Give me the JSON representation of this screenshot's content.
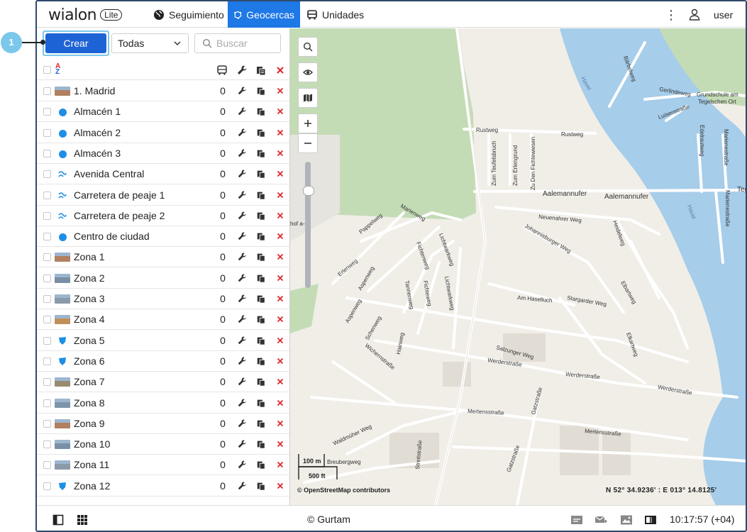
{
  "app": {
    "logo_word": "wialon",
    "logo_badge": "Lite"
  },
  "nav": {
    "tabs": [
      {
        "label": "Seguimiento",
        "icon": "globe-icon",
        "active": false
      },
      {
        "label": "Geocercas",
        "icon": "geofence-icon",
        "active": true
      },
      {
        "label": "Unidades",
        "icon": "bus-icon",
        "active": false
      }
    ],
    "user": "user"
  },
  "toolbar": {
    "create_label": "Crear",
    "filter_value": "Todas",
    "search_placeholder": "Buscar"
  },
  "callout": "1",
  "geofences": [
    {
      "name": "1. Madrid",
      "count": "0",
      "icon": "image-thumb"
    },
    {
      "name": "Almacén 1",
      "count": "0",
      "icon": "circle"
    },
    {
      "name": "Almacén 2",
      "count": "0",
      "icon": "circle"
    },
    {
      "name": "Almacén 3",
      "count": "0",
      "icon": "circle"
    },
    {
      "name": "Avenida Central",
      "count": "0",
      "icon": "line"
    },
    {
      "name": "Carretera de peaje 1",
      "count": "0",
      "icon": "line"
    },
    {
      "name": "Carretera de peaje 2",
      "count": "0",
      "icon": "line"
    },
    {
      "name": "Centro de ciudad",
      "count": "0",
      "icon": "circle"
    },
    {
      "name": "Zona 1",
      "count": "0",
      "icon": "image-thumb"
    },
    {
      "name": "Zona 2",
      "count": "0",
      "icon": "image-thumb"
    },
    {
      "name": "Zona 3",
      "count": "0",
      "icon": "image-thumb"
    },
    {
      "name": "Zona 4",
      "count": "0",
      "icon": "image-thumb"
    },
    {
      "name": "Zona 5",
      "count": "0",
      "icon": "polygon"
    },
    {
      "name": "Zona 6",
      "count": "0",
      "icon": "polygon"
    },
    {
      "name": "Zona 7",
      "count": "0",
      "icon": "image-thumb"
    },
    {
      "name": "Zona 8",
      "count": "0",
      "icon": "image-thumb"
    },
    {
      "name": "Zona 9",
      "count": "0",
      "icon": "image-thumb"
    },
    {
      "name": "Zona 10",
      "count": "0",
      "icon": "image-thumb"
    },
    {
      "name": "Zona 11",
      "count": "0",
      "icon": "image-thumb"
    },
    {
      "name": "Zona 12",
      "count": "0",
      "icon": "polygon"
    }
  ],
  "map": {
    "scale_metric": "100 m",
    "scale_imperial": "500 ft",
    "attribution": "© OpenStreetMap contributors",
    "coordinates": "N 52° 34.9236' : E 013° 14.8125'",
    "street_labels": [
      "Bärbelweg",
      "Havel",
      "Gerlindeweg",
      "Grundschule am",
      "Tegelschen Ort",
      "Luisenstraße",
      "Rustweg",
      "Rustweg",
      "Zum Teufelsbruch",
      "Zum Erlengrund",
      "Zu Den Fichtewiesen",
      "Edelrautweg",
      "Marienestraße",
      "Aalemannufer",
      "Aalemannufer",
      "Teg",
      "Neuenahrer Weg",
      "Johannisburger Weg",
      "Heidelweg",
      "Havel",
      "Marienestraße",
      "Pappelweg",
      "Marienweg",
      "Fichtenweg",
      "Lichtwarkweg",
      "Erlenweg",
      "Aspenweg",
      "Tannenweg",
      "Fichteweg",
      "Lichtwarkweg",
      "Am Haselluch",
      "Stargarder Weg",
      "Elbartweg",
      "Aspenweg",
      "Schenweg",
      "Hainweg",
      "Salzunger Weg",
      "Elkartweg",
      "Wichernstraße",
      "Werderstraße",
      "Werderstraße",
      "Werderstraße",
      "Mertensstraße",
      "Mertensstraße",
      "Gatzstraße",
      "Waldmüher Weg",
      "Breubergweg",
      "Streitstraße",
      "Gatzstraße",
      "hof a-g"
    ],
    "accent_water": "#a6cdea",
    "accent_green": "#bcd8b2"
  },
  "footer": {
    "copyright": "© Gurtam",
    "clock": "10:17:57 (+04)"
  },
  "colors": {
    "primary": "#1e63d6",
    "tab_active": "#1e78e6",
    "delete": "#e0262b",
    "callout": "#7cc8ea"
  }
}
